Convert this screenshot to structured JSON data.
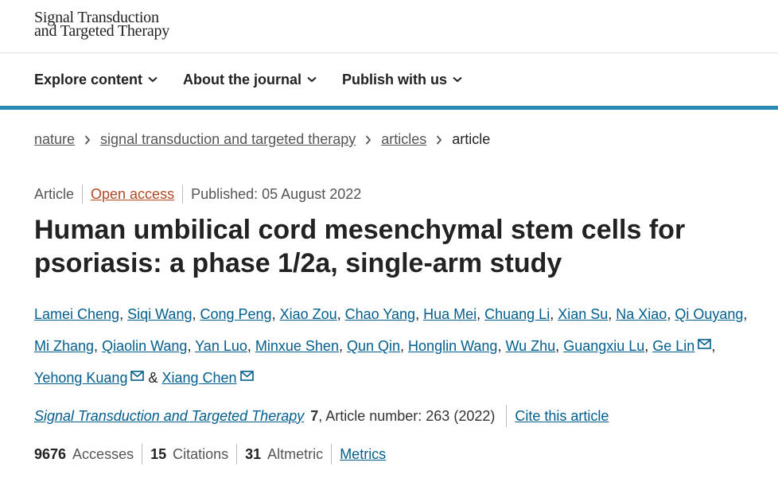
{
  "logo": {
    "line1": "Signal Transduction",
    "line2": "and Targeted Therapy"
  },
  "nav": {
    "items": [
      {
        "label": "Explore content"
      },
      {
        "label": "About the journal"
      },
      {
        "label": "Publish with us"
      }
    ]
  },
  "breadcrumb": {
    "items": [
      "nature",
      "signal transduction and targeted therapy",
      "articles"
    ],
    "current": "article"
  },
  "meta": {
    "type": "Article",
    "access": "Open access",
    "published": "Published: 05 August 2022"
  },
  "title": {
    "line1": "Human umbilical cord mesenchymal stem cells for",
    "line2": "psoriasis: a phase 1/2a, single-arm study"
  },
  "authors": [
    "Lamei Cheng",
    "Siqi Wang",
    "Cong Peng",
    "Xiao Zou",
    "Chao Yang",
    "Hua Mei",
    "Chuang Li",
    "Xian Su",
    "Na Xiao",
    "Qi Ouyang",
    "Mi Zhang",
    "Qiaolin Wang",
    "Yan Luo",
    "Minxue Shen",
    "Qun Qin",
    "Honglin Wang",
    "Wu Zhu",
    "Guangxiu Lu",
    "Ge Lin",
    "Yehong Kuang",
    "Xiang Chen"
  ],
  "author_separators": {
    "comma": ", ",
    "ampersand": " & "
  },
  "journal": {
    "name": "Signal Transduction and Targeted Therapy",
    "volume": "7",
    "article_number": ", Article number: 263 (2022)",
    "cite": "Cite this article"
  },
  "metrics": {
    "accesses_value": "9676",
    "accesses_label": "Accesses",
    "citations_value": "15",
    "citations_label": "Citations",
    "altmetric_value": "31",
    "altmetric_label": "Altmetric",
    "link": "Metrics"
  },
  "colors": {
    "accent": "#2a8ab3",
    "link": "#025e8d",
    "open_access": "#b24924"
  }
}
